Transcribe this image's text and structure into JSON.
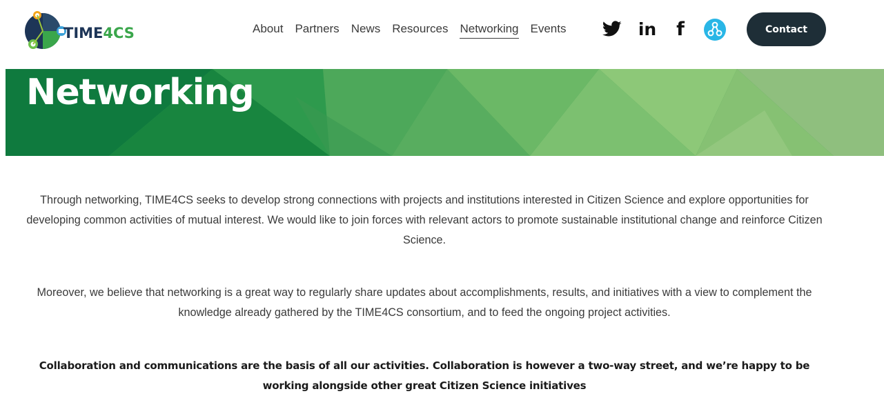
{
  "brand": {
    "logo_text_part1": "TIME",
    "logo_text_part2": "4CS",
    "dark_color": "#1d3557",
    "green_color": "#3aa64b"
  },
  "nav": {
    "items": [
      {
        "label": "About"
      },
      {
        "label": "Partners"
      },
      {
        "label": "News"
      },
      {
        "label": "Resources"
      },
      {
        "label": "Networking",
        "active": true
      },
      {
        "label": "Events"
      }
    ]
  },
  "social": [
    {
      "icon": "twitter-icon"
    },
    {
      "icon": "linkedin-icon",
      "glyph": "in"
    },
    {
      "icon": "facebook-icon",
      "glyph": "f"
    },
    {
      "icon": "network-icon",
      "color": "#29b6e6"
    }
  ],
  "contact_button": {
    "label": "Contact",
    "bg": "#1e2e37"
  },
  "banner": {
    "title": "Networking"
  },
  "content": {
    "paragraph1": "Through networking, TIME4CS seeks to develop strong connections with projects and institutions interested in Citizen Science and explore opportunities for developing common activities of mutual interest. We would like to join forces with relevant actors to promote sustainable institutional change and reinforce Citizen Science.",
    "paragraph2": "Moreover, we believe that networking is a great way to regularly share updates about accomplishments, results, and initiatives with a view to complement the knowledge already gathered by the TIME4CS consortium, and to feed the ongoing project activities.",
    "paragraph3": "Collaboration and communications are the basis of all our activities. Collaboration is however a two-way street, and we’re happy to be working alongside other great Citizen Science initiatives"
  }
}
